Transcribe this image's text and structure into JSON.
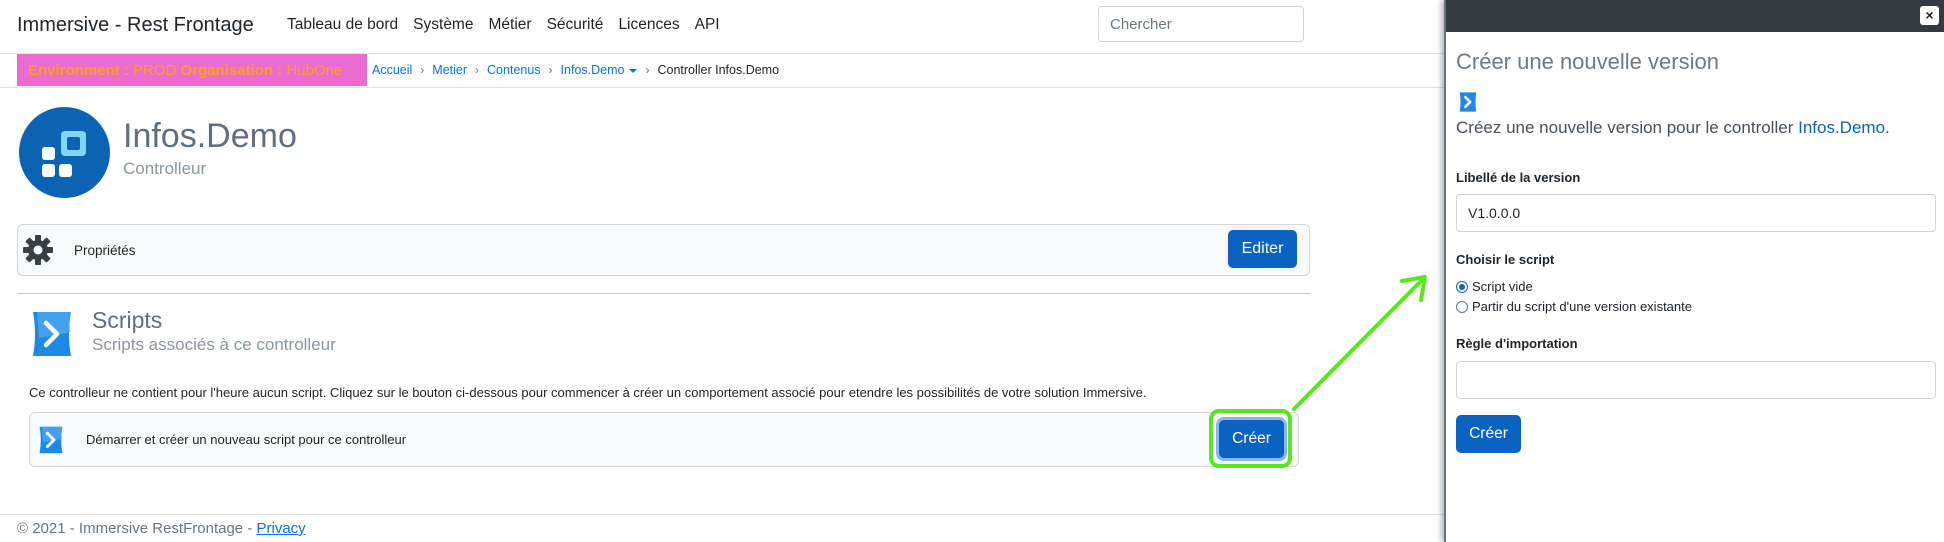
{
  "navbar": {
    "brand": "Immersive - Rest Frontage",
    "items": [
      "Tableau de bord",
      "Système",
      "Métier",
      "Sécurité",
      "Licences",
      "API"
    ],
    "search_placeholder": "Chercher"
  },
  "env": {
    "env_label": "Environment :",
    "env_value": "PROD",
    "org_label": "Organisation :",
    "org_value": "HubOne"
  },
  "breadcrumb": {
    "items": [
      "Accueil",
      "Metier",
      "Contenus",
      "Infos.Demo"
    ],
    "current": "Controller Infos.Demo"
  },
  "header": {
    "title": "Infos.Demo",
    "subtitle": "Controlleur"
  },
  "properties": {
    "label": "Propriétés",
    "edit_button": "Editer"
  },
  "scripts": {
    "title": "Scripts",
    "subtitle": "Scripts associés à ce controlleur",
    "empty_text": "Ce controlleur ne contient pour l'heure aucun script. Cliquez sur le bouton ci-dessous pour commencer à créer un comportement associé pour etendre les possibilités de votre solution Immersive.",
    "create_card_label": "Démarrer et créer un nouveau script pour ce controlleur",
    "create_button": "Créer"
  },
  "footer": {
    "text": "© 2021 - Immersive RestFrontage -",
    "privacy": "Privacy"
  },
  "panel": {
    "close": "×",
    "title": "Créer une nouvelle version",
    "lead_prefix": "Créez une nouvelle version pour le controller",
    "lead_controller": "Infos.Demo",
    "lead_suffix": ".",
    "version_label": "Libellé de la version",
    "version_value": "V1.0.0.0",
    "script_label": "Choisir le script",
    "script_options": [
      "Script vide",
      "Partir du script d'une version existante"
    ],
    "script_selected": 0,
    "import_label": "Règle d'importation",
    "import_value": "",
    "create_button": "Créer"
  },
  "colors": {
    "primary": "#0b63c1",
    "env_badge_bg": "#ec6bd1",
    "env_badge_text": "#ff9d1c",
    "highlight": "#56e81a",
    "panel_topbar": "#343a40"
  }
}
